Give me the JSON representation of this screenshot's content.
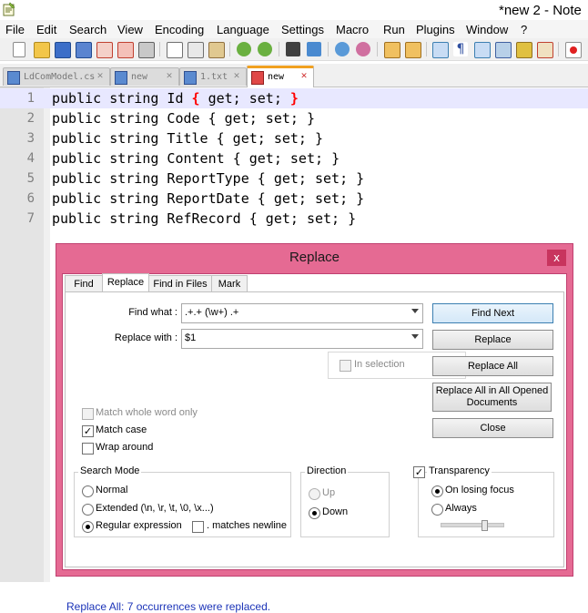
{
  "window": {
    "title": "*new  2 - Note"
  },
  "menu": [
    "File",
    "Edit",
    "Search",
    "View",
    "Encoding",
    "Language",
    "Settings",
    "Macro",
    "Run",
    "Plugins",
    "Window",
    "?"
  ],
  "toolbar_icons": [
    "new-file-icon",
    "open-file-icon",
    "save-icon",
    "save-all-icon",
    "close-icon",
    "close-all-icon",
    "print-icon",
    "cut-icon",
    "copy-icon",
    "paste-icon",
    "undo-icon",
    "redo-icon",
    "find-icon",
    "replace-icon",
    "zoom-in-icon",
    "zoom-out-icon",
    "sync-vertical-icon",
    "sync-horizontal-icon",
    "word-wrap-icon",
    "show-all-chars-icon",
    "indent-guide-icon",
    "doc-map-icon",
    "function-list-icon",
    "folder-workspace-icon",
    "record-macro-icon"
  ],
  "tabs": [
    {
      "label": "LdComModel.cs",
      "active": false
    },
    {
      "label": "new  ",
      "active": false
    },
    {
      "label": "1.txt",
      "active": false
    },
    {
      "label": "new  ",
      "active": true
    }
  ],
  "editor": {
    "lines": [
      {
        "num": "1",
        "prefix": "public string Id ",
        "open": "{",
        "middle": " get; set; ",
        "close": "}",
        "highlight": true
      },
      {
        "num": "2",
        "prefix": "public string Code ",
        "open": "{",
        "middle": " get; set; ",
        "close": "}",
        "highlight": false
      },
      {
        "num": "3",
        "prefix": "public string Title ",
        "open": "{",
        "middle": " get; set; ",
        "close": "}",
        "highlight": false
      },
      {
        "num": "4",
        "prefix": "public string Content ",
        "open": "{",
        "middle": " get; set; ",
        "close": "}",
        "highlight": false
      },
      {
        "num": "5",
        "prefix": "public string ReportType ",
        "open": "{",
        "middle": " get; set; ",
        "close": "}",
        "highlight": false
      },
      {
        "num": "6",
        "prefix": "public string ReportDate ",
        "open": "{",
        "middle": " get; set; ",
        "close": "}",
        "highlight": false
      },
      {
        "num": "7",
        "prefix": "public string RefRecord ",
        "open": "{",
        "middle": " get; set; ",
        "close": "}",
        "highlight": false
      }
    ]
  },
  "dialog": {
    "title": "Replace",
    "close_label": "x",
    "tabs": [
      "Find",
      "Replace",
      "Find in Files",
      "Mark"
    ],
    "active_tab": "Replace",
    "find_what_label": "Find what :",
    "find_what_value": ".+.+ (\\w+) .+",
    "replace_with_label": "Replace with :",
    "replace_with_value": "$1",
    "in_selection_label": "In selection",
    "buttons": {
      "find_next": "Find Next",
      "replace": "Replace",
      "replace_all": "Replace All",
      "replace_all_opened": "Replace All in All Opened Documents",
      "close": "Close"
    },
    "options": {
      "match_whole_word": {
        "label": "Match whole word only",
        "checked": false,
        "enabled": false
      },
      "match_case": {
        "label": "Match case",
        "checked": true,
        "enabled": true
      },
      "wrap_around": {
        "label": "Wrap around",
        "checked": false,
        "enabled": true
      }
    },
    "search_mode": {
      "title": "Search Mode",
      "normal": "Normal",
      "extended": "Extended (\\n, \\r, \\t, \\0, \\x...)",
      "regex": "Regular expression",
      "matches_newline": ". matches newline",
      "selected": "regex"
    },
    "direction": {
      "title": "Direction",
      "up": "Up",
      "down": "Down",
      "selected": "down"
    },
    "transparency": {
      "title": "Transparency",
      "checked": true,
      "on_losing_focus": "On losing focus",
      "always": "Always",
      "selected": "on_losing_focus",
      "slider_level": 0.7
    },
    "status": "Replace All: 7 occurrences were replaced."
  },
  "colors": {
    "dialog_frame": "#e56a93",
    "status_text": "#1c34b8",
    "brace_highlight": "#ff0000",
    "current_line": "#e8e8ff"
  }
}
